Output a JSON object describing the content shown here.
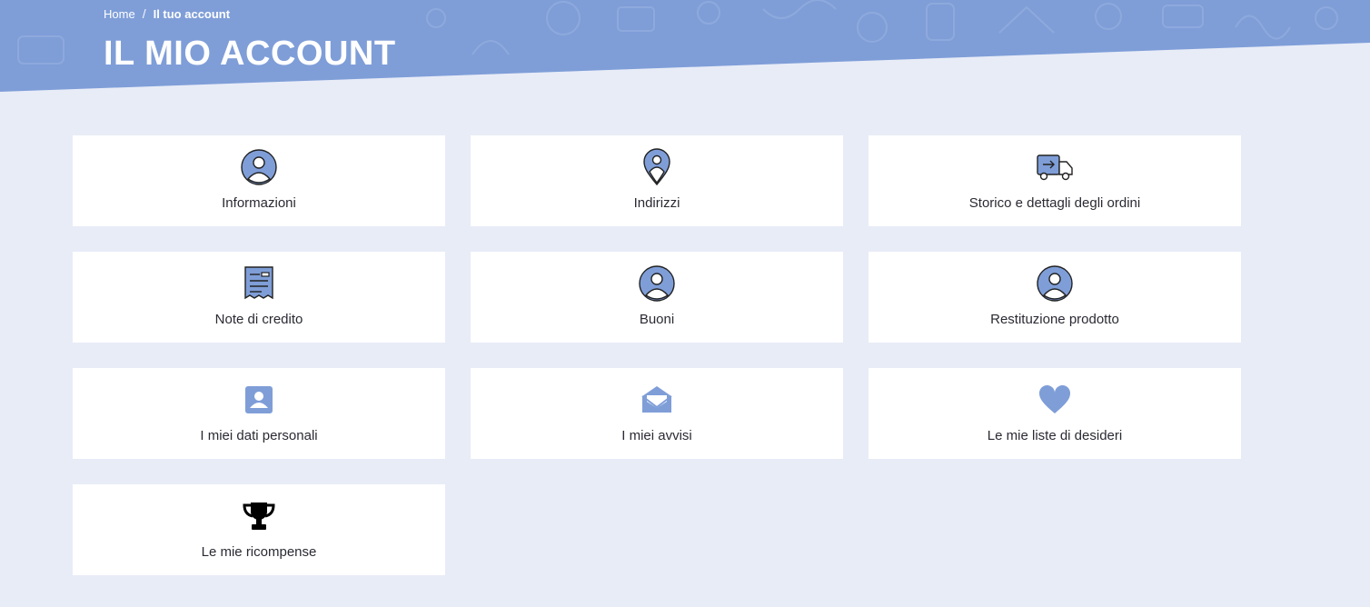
{
  "breadcrumb": {
    "home": "Home",
    "separator": "/",
    "current": "Il tuo account"
  },
  "page": {
    "title": "IL MIO ACCOUNT"
  },
  "colors": {
    "accent": "#7f9ed8",
    "background": "#e8ecf7",
    "card": "#ffffff",
    "text": "#2a2a33"
  },
  "cards": [
    {
      "label": "Informazioni",
      "icon": "user-circle-icon"
    },
    {
      "label": "Indirizzi",
      "icon": "map-pin-icon"
    },
    {
      "label": "Storico e dettagli degli ordini",
      "icon": "delivery-truck-icon"
    },
    {
      "label": "Note di credito",
      "icon": "receipt-icon"
    },
    {
      "label": "Buoni",
      "icon": "user-circle-icon"
    },
    {
      "label": "Restituzione prodotto",
      "icon": "user-circle-icon"
    },
    {
      "label": "I miei dati personali",
      "icon": "id-card-icon"
    },
    {
      "label": "I miei avvisi",
      "icon": "envelope-open-icon"
    },
    {
      "label": "Le mie liste di desideri",
      "icon": "heart-icon"
    },
    {
      "label": "Le mie ricompense",
      "icon": "trophy-icon"
    }
  ]
}
